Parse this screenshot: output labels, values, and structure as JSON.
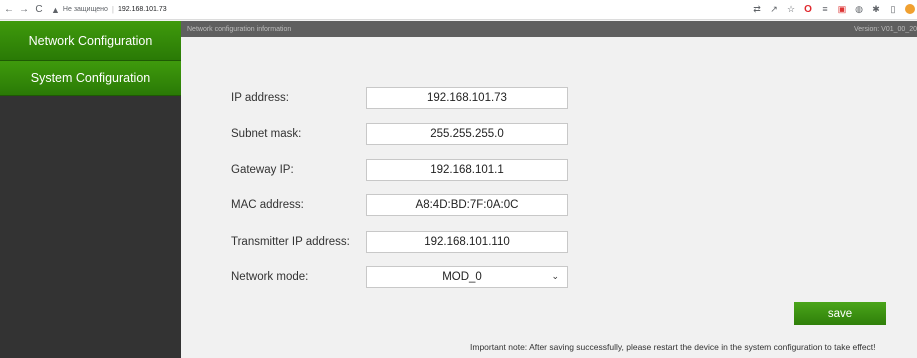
{
  "browser": {
    "back": "←",
    "forward": "→",
    "reload": "C",
    "warning": "▲",
    "insecure_text": "Не защищено",
    "separator": "|",
    "url": "192.168.101.73"
  },
  "sidebar": {
    "items": [
      {
        "label": "Network Configuration"
      },
      {
        "label": "System Configuration"
      }
    ]
  },
  "info_bar": {
    "title": "Network configuration information",
    "version": "Version: V01_00_20"
  },
  "form": {
    "ip_label": "IP address:",
    "ip_value": "192.168.101.73",
    "subnet_label": "Subnet mask:",
    "subnet_value": "255.255.255.0",
    "gateway_label": "Gateway IP:",
    "gateway_value": "192.168.101.1",
    "mac_label": "MAC address:",
    "mac_value": "A8:4D:BD:7F:0A:0C",
    "transmitter_label": "Transmitter IP address:",
    "transmitter_value": "192.168.101.110",
    "mode_label": "Network mode:",
    "mode_value": "MOD_0",
    "mode_chevron": "⌄"
  },
  "save_label": "save",
  "note": "Important note: After saving successfully, please restart the device in the system configuration to take effect!",
  "colors": {
    "sidebar_bg": "#333333",
    "nav_green": "#3f9a0c",
    "info_bar_bg": "#5f5f5f",
    "content_bg": "#f1f1f1",
    "button_green": "#4aa51a"
  },
  "icons": [
    "back-arrow-icon",
    "forward-arrow-icon",
    "reload-icon",
    "warning-icon",
    "translate-icon",
    "share-icon",
    "star-icon",
    "opera-icon",
    "extension-icon",
    "extension-icon",
    "extension-icon",
    "pin-icon",
    "sidebar-icon"
  ]
}
